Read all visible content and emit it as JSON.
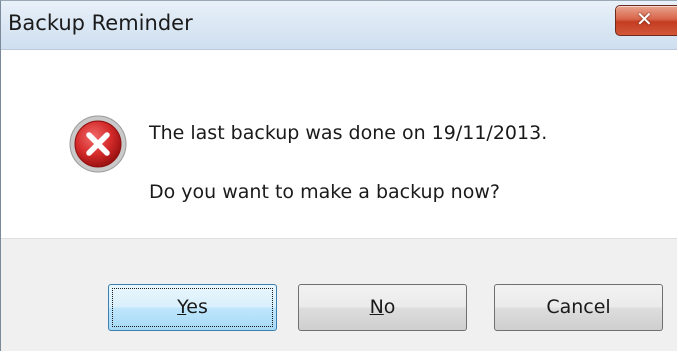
{
  "window": {
    "title": "Backup Reminder",
    "close_glyph": "✕"
  },
  "message": {
    "icon": "error-icon",
    "line1": "The last backup was done on 19/11/2013.",
    "line2": "Do you want to make a backup now?"
  },
  "buttons": {
    "yes": {
      "mnemonic": "Y",
      "rest": "es"
    },
    "no": {
      "mnemonic": "N",
      "rest": "o"
    },
    "cancel": {
      "label": "Cancel"
    }
  },
  "colors": {
    "titlebar": "#dce8f4",
    "close_button": "#c43d22",
    "footer": "#f0f0f0",
    "default_button_border": "#3c7fb1",
    "error_icon": "#d42a2a"
  }
}
